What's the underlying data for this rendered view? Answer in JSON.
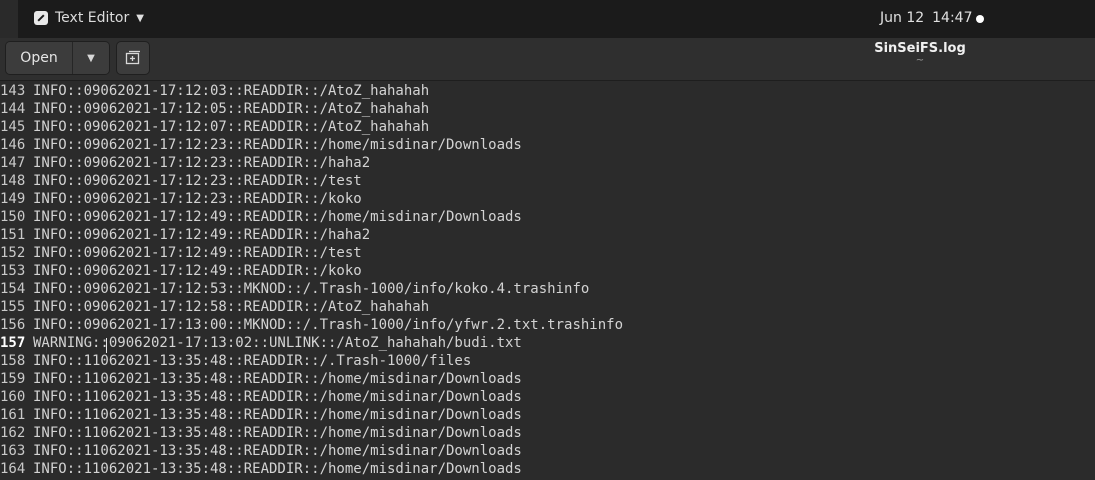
{
  "topbar": {
    "app_name": "Text Editor",
    "date": "Jun 12",
    "time": "14:47"
  },
  "header": {
    "open_label": "Open",
    "title": "SinSeiFS.log",
    "subtitle": "~"
  },
  "editor": {
    "cut_line": "                                             ",
    "lines": [
      {
        "num": "143",
        "text": "INFO::09062021-17:12:03::READDIR::/AtoZ_hahahah"
      },
      {
        "num": "144",
        "text": "INFO::09062021-17:12:05::READDIR::/AtoZ_hahahah"
      },
      {
        "num": "145",
        "text": "INFO::09062021-17:12:07::READDIR::/AtoZ_hahahah"
      },
      {
        "num": "146",
        "text": "INFO::09062021-17:12:23::READDIR::/home/misdinar/Downloads"
      },
      {
        "num": "147",
        "text": "INFO::09062021-17:12:23::READDIR::/haha2"
      },
      {
        "num": "148",
        "text": "INFO::09062021-17:12:23::READDIR::/test"
      },
      {
        "num": "149",
        "text": "INFO::09062021-17:12:23::READDIR::/koko"
      },
      {
        "num": "150",
        "text": "INFO::09062021-17:12:49::READDIR::/home/misdinar/Downloads"
      },
      {
        "num": "151",
        "text": "INFO::09062021-17:12:49::READDIR::/haha2"
      },
      {
        "num": "152",
        "text": "INFO::09062021-17:12:49::READDIR::/test"
      },
      {
        "num": "153",
        "text": "INFO::09062021-17:12:49::READDIR::/koko"
      },
      {
        "num": "154",
        "text": "INFO::09062021-17:12:53::MKNOD::/.Trash-1000/info/koko.4.trashinfo"
      },
      {
        "num": "155",
        "text": "INFO::09062021-17:12:58::READDIR::/AtoZ_hahahah"
      },
      {
        "num": "156",
        "text": "INFO::09062021-17:13:00::MKNOD::/.Trash-1000/info/yfwr.2.txt.trashinfo"
      },
      {
        "num": "157",
        "text": "WARNING::09062021-17:13:02::UNLINK::/AtoZ_hahahah/budi.txt",
        "current": true
      },
      {
        "num": "158",
        "text": "INFO::11062021-13:35:48::READDIR::/.Trash-1000/files"
      },
      {
        "num": "159",
        "text": "INFO::11062021-13:35:48::READDIR::/home/misdinar/Downloads"
      },
      {
        "num": "160",
        "text": "INFO::11062021-13:35:48::READDIR::/home/misdinar/Downloads"
      },
      {
        "num": "161",
        "text": "INFO::11062021-13:35:48::READDIR::/home/misdinar/Downloads"
      },
      {
        "num": "162",
        "text": "INFO::11062021-13:35:48::READDIR::/home/misdinar/Downloads"
      },
      {
        "num": "163",
        "text": "INFO::11062021-13:35:48::READDIR::/home/misdinar/Downloads"
      },
      {
        "num": "164",
        "text": "INFO::11062021-13:35:48::READDIR::/home/misdinar/Downloads"
      }
    ]
  }
}
